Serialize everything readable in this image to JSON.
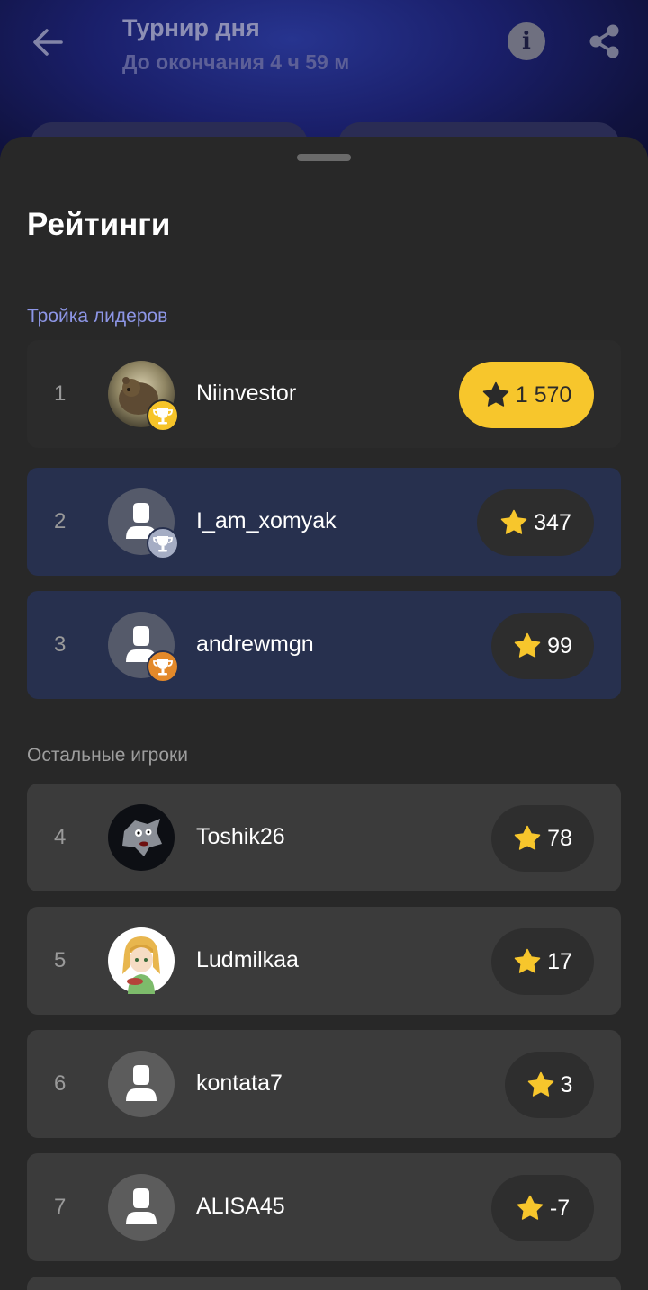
{
  "header": {
    "title": "Турнир дня",
    "subtitle": "До окончания 4 ч 59 м"
  },
  "sheet": {
    "title": "Рейтинги",
    "top_label": "Тройка лидеров",
    "rest_label": "Остальные игроки"
  },
  "leaders": [
    {
      "rank": "1",
      "name": "Niinvestor",
      "score": "1 570",
      "medal": "gold"
    },
    {
      "rank": "2",
      "name": "I_am_xomyak",
      "score": "347",
      "medal": "silver"
    },
    {
      "rank": "3",
      "name": "andrewmgn",
      "score": "99",
      "medal": "bronze"
    }
  ],
  "players": [
    {
      "rank": "4",
      "name": "Toshik26",
      "score": "78"
    },
    {
      "rank": "5",
      "name": "Ludmilkaa",
      "score": "17"
    },
    {
      "rank": "6",
      "name": "kontata7",
      "score": "3"
    },
    {
      "rank": "7",
      "name": "ALISA45",
      "score": "-7"
    }
  ],
  "colors": {
    "accent_gold": "#f7c62c",
    "leader_row": "#27304e",
    "section_blue": "#8d96e6"
  },
  "icons": [
    "back-arrow-icon",
    "info-icon",
    "share-icon",
    "star-icon",
    "trophy-icon",
    "default-avatar-icon"
  ]
}
